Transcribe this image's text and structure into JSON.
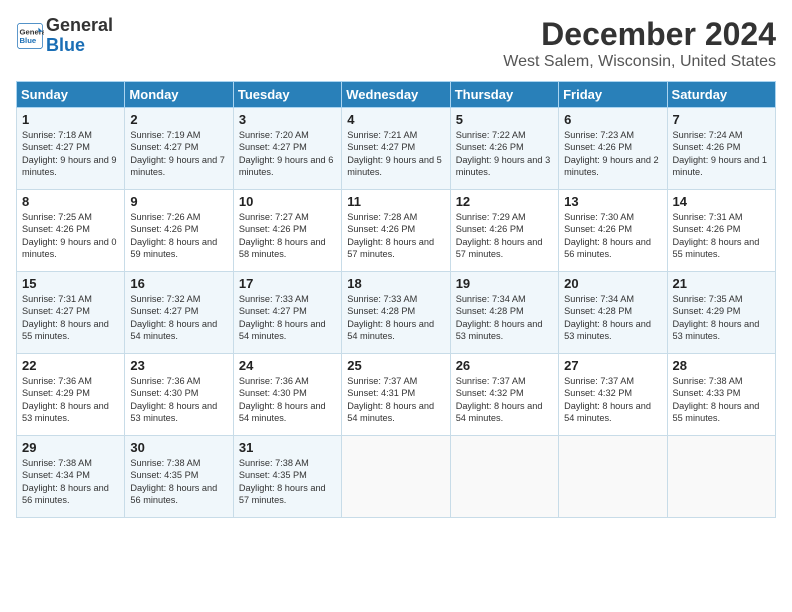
{
  "header": {
    "logo_line1": "General",
    "logo_line2": "Blue",
    "title": "December 2024",
    "location": "West Salem, Wisconsin, United States"
  },
  "days_of_week": [
    "Sunday",
    "Monday",
    "Tuesday",
    "Wednesday",
    "Thursday",
    "Friday",
    "Saturday"
  ],
  "weeks": [
    [
      {
        "num": "1",
        "sunrise": "Sunrise: 7:18 AM",
        "sunset": "Sunset: 4:27 PM",
        "daylight": "Daylight: 9 hours and 9 minutes."
      },
      {
        "num": "2",
        "sunrise": "Sunrise: 7:19 AM",
        "sunset": "Sunset: 4:27 PM",
        "daylight": "Daylight: 9 hours and 7 minutes."
      },
      {
        "num": "3",
        "sunrise": "Sunrise: 7:20 AM",
        "sunset": "Sunset: 4:27 PM",
        "daylight": "Daylight: 9 hours and 6 minutes."
      },
      {
        "num": "4",
        "sunrise": "Sunrise: 7:21 AM",
        "sunset": "Sunset: 4:27 PM",
        "daylight": "Daylight: 9 hours and 5 minutes."
      },
      {
        "num": "5",
        "sunrise": "Sunrise: 7:22 AM",
        "sunset": "Sunset: 4:26 PM",
        "daylight": "Daylight: 9 hours and 3 minutes."
      },
      {
        "num": "6",
        "sunrise": "Sunrise: 7:23 AM",
        "sunset": "Sunset: 4:26 PM",
        "daylight": "Daylight: 9 hours and 2 minutes."
      },
      {
        "num": "7",
        "sunrise": "Sunrise: 7:24 AM",
        "sunset": "Sunset: 4:26 PM",
        "daylight": "Daylight: 9 hours and 1 minute."
      }
    ],
    [
      {
        "num": "8",
        "sunrise": "Sunrise: 7:25 AM",
        "sunset": "Sunset: 4:26 PM",
        "daylight": "Daylight: 9 hours and 0 minutes."
      },
      {
        "num": "9",
        "sunrise": "Sunrise: 7:26 AM",
        "sunset": "Sunset: 4:26 PM",
        "daylight": "Daylight: 8 hours and 59 minutes."
      },
      {
        "num": "10",
        "sunrise": "Sunrise: 7:27 AM",
        "sunset": "Sunset: 4:26 PM",
        "daylight": "Daylight: 8 hours and 58 minutes."
      },
      {
        "num": "11",
        "sunrise": "Sunrise: 7:28 AM",
        "sunset": "Sunset: 4:26 PM",
        "daylight": "Daylight: 8 hours and 57 minutes."
      },
      {
        "num": "12",
        "sunrise": "Sunrise: 7:29 AM",
        "sunset": "Sunset: 4:26 PM",
        "daylight": "Daylight: 8 hours and 57 minutes."
      },
      {
        "num": "13",
        "sunrise": "Sunrise: 7:30 AM",
        "sunset": "Sunset: 4:26 PM",
        "daylight": "Daylight: 8 hours and 56 minutes."
      },
      {
        "num": "14",
        "sunrise": "Sunrise: 7:31 AM",
        "sunset": "Sunset: 4:26 PM",
        "daylight": "Daylight: 8 hours and 55 minutes."
      }
    ],
    [
      {
        "num": "15",
        "sunrise": "Sunrise: 7:31 AM",
        "sunset": "Sunset: 4:27 PM",
        "daylight": "Daylight: 8 hours and 55 minutes."
      },
      {
        "num": "16",
        "sunrise": "Sunrise: 7:32 AM",
        "sunset": "Sunset: 4:27 PM",
        "daylight": "Daylight: 8 hours and 54 minutes."
      },
      {
        "num": "17",
        "sunrise": "Sunrise: 7:33 AM",
        "sunset": "Sunset: 4:27 PM",
        "daylight": "Daylight: 8 hours and 54 minutes."
      },
      {
        "num": "18",
        "sunrise": "Sunrise: 7:33 AM",
        "sunset": "Sunset: 4:28 PM",
        "daylight": "Daylight: 8 hours and 54 minutes."
      },
      {
        "num": "19",
        "sunrise": "Sunrise: 7:34 AM",
        "sunset": "Sunset: 4:28 PM",
        "daylight": "Daylight: 8 hours and 53 minutes."
      },
      {
        "num": "20",
        "sunrise": "Sunrise: 7:34 AM",
        "sunset": "Sunset: 4:28 PM",
        "daylight": "Daylight: 8 hours and 53 minutes."
      },
      {
        "num": "21",
        "sunrise": "Sunrise: 7:35 AM",
        "sunset": "Sunset: 4:29 PM",
        "daylight": "Daylight: 8 hours and 53 minutes."
      }
    ],
    [
      {
        "num": "22",
        "sunrise": "Sunrise: 7:36 AM",
        "sunset": "Sunset: 4:29 PM",
        "daylight": "Daylight: 8 hours and 53 minutes."
      },
      {
        "num": "23",
        "sunrise": "Sunrise: 7:36 AM",
        "sunset": "Sunset: 4:30 PM",
        "daylight": "Daylight: 8 hours and 53 minutes."
      },
      {
        "num": "24",
        "sunrise": "Sunrise: 7:36 AM",
        "sunset": "Sunset: 4:30 PM",
        "daylight": "Daylight: 8 hours and 54 minutes."
      },
      {
        "num": "25",
        "sunrise": "Sunrise: 7:37 AM",
        "sunset": "Sunset: 4:31 PM",
        "daylight": "Daylight: 8 hours and 54 minutes."
      },
      {
        "num": "26",
        "sunrise": "Sunrise: 7:37 AM",
        "sunset": "Sunset: 4:32 PM",
        "daylight": "Daylight: 8 hours and 54 minutes."
      },
      {
        "num": "27",
        "sunrise": "Sunrise: 7:37 AM",
        "sunset": "Sunset: 4:32 PM",
        "daylight": "Daylight: 8 hours and 54 minutes."
      },
      {
        "num": "28",
        "sunrise": "Sunrise: 7:38 AM",
        "sunset": "Sunset: 4:33 PM",
        "daylight": "Daylight: 8 hours and 55 minutes."
      }
    ],
    [
      {
        "num": "29",
        "sunrise": "Sunrise: 7:38 AM",
        "sunset": "Sunset: 4:34 PM",
        "daylight": "Daylight: 8 hours and 56 minutes."
      },
      {
        "num": "30",
        "sunrise": "Sunrise: 7:38 AM",
        "sunset": "Sunset: 4:35 PM",
        "daylight": "Daylight: 8 hours and 56 minutes."
      },
      {
        "num": "31",
        "sunrise": "Sunrise: 7:38 AM",
        "sunset": "Sunset: 4:35 PM",
        "daylight": "Daylight: 8 hours and 57 minutes."
      },
      null,
      null,
      null,
      null
    ]
  ]
}
